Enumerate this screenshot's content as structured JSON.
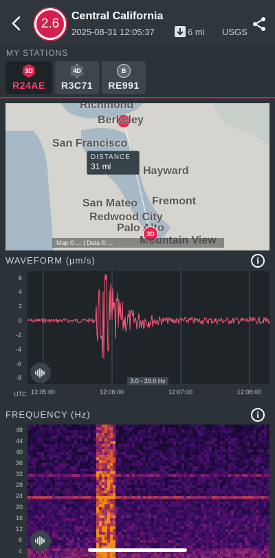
{
  "header": {
    "magnitude": "2.6",
    "region": "Central California",
    "datetime": "2025-08-31 12:05:37",
    "depth": "6 mi",
    "source": "USGS",
    "icons": {
      "back": "back-chevron-icon",
      "depth": "down-arrow-icon",
      "share": "share-icon"
    }
  },
  "stations": {
    "label": "MY STATIONS",
    "items": [
      {
        "tag": "3D",
        "name": "R24AE",
        "selected": true
      },
      {
        "tag": "4D",
        "name": "R3C71",
        "selected": false
      },
      {
        "tag": "B",
        "name": "RE991",
        "selected": false
      }
    ]
  },
  "map": {
    "places": [
      "Richmond",
      "Berkeley",
      "San Francisco",
      "Hayward",
      "San Mateo",
      "Fremont",
      "Redwood City",
      "Palo Alto",
      "Mountain View"
    ],
    "distance_label": "DISTANCE",
    "distance_value": "31 mi",
    "station_tag": "3D",
    "credit": "Map © ... | Data © ..."
  },
  "waveform": {
    "label": "WAVEFORM (µm/s)",
    "y_ticks": [
      "6",
      "4",
      "2",
      "0",
      "-2",
      "-4",
      "-6",
      "-8"
    ],
    "x_ticks": [
      "12:05:00",
      "12:06:00",
      "12:07:00",
      "12:08:00"
    ],
    "tz": "UTC",
    "band": "3.0 - 20.0 Hz",
    "line_color": "#ff5a7d"
  },
  "frequency": {
    "label": "FREQUENCY (Hz)",
    "y_ticks": [
      "48",
      "44",
      "40",
      "36",
      "32",
      "28",
      "24",
      "20",
      "16",
      "12",
      "8",
      "4"
    ]
  },
  "colors": {
    "accent": "#d61f4b",
    "background": "#2b3339"
  }
}
